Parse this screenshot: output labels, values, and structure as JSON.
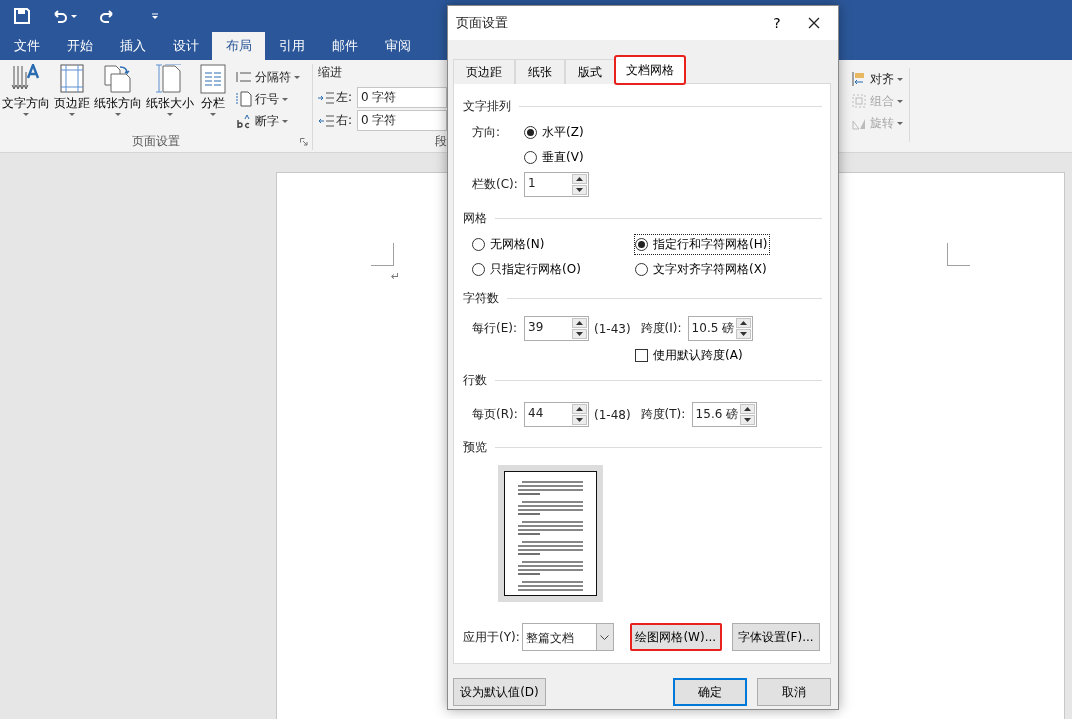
{
  "word": {
    "tabs": [
      {
        "label": "文件",
        "selected": false
      },
      {
        "label": "开始",
        "selected": false
      },
      {
        "label": "插入",
        "selected": false
      },
      {
        "label": "设计",
        "selected": false
      },
      {
        "label": "布局",
        "selected": true
      },
      {
        "label": "引用",
        "selected": false
      },
      {
        "label": "邮件",
        "selected": false
      },
      {
        "label": "审阅",
        "selected": false
      }
    ],
    "page_setup_group": {
      "title": "页面设置",
      "large_buttons": [
        {
          "label": "文字方向"
        },
        {
          "label": "页边距"
        },
        {
          "label": "纸张方向"
        },
        {
          "label": "纸张大小"
        },
        {
          "label": "分栏"
        }
      ],
      "small_buttons": [
        {
          "label": "分隔符"
        },
        {
          "label": "行号"
        },
        {
          "label": "断字"
        }
      ]
    },
    "indent_group": {
      "heading": "缩进",
      "fields": [
        {
          "label": "左:",
          "value": "0 字符"
        },
        {
          "label": "右:",
          "value": "0 字符"
        }
      ],
      "title": "段"
    },
    "arrange_buttons": [
      {
        "label": "对齐",
        "disabled": false
      },
      {
        "label": "组合",
        "disabled": true
      },
      {
        "label": "旋转",
        "disabled": true
      }
    ],
    "document": {
      "paragraph_mark": "↵"
    }
  },
  "dialog": {
    "title": "页面设置",
    "help": "?",
    "tabs": [
      {
        "label": "页边距",
        "selected": false,
        "highlighted": false
      },
      {
        "label": "纸张",
        "selected": false,
        "highlighted": false
      },
      {
        "label": "版式",
        "selected": false,
        "highlighted": false
      },
      {
        "label": "文档网格",
        "selected": true,
        "highlighted": true
      }
    ],
    "text_direction": {
      "heading": "文字排列",
      "direction_label": "方向:",
      "options": [
        {
          "label": "水平(Z)",
          "selected": true
        },
        {
          "label": "垂直(V)",
          "selected": false
        }
      ],
      "columns_label": "栏数(C):",
      "columns_value": "1"
    },
    "grid": {
      "heading": "网格",
      "options": [
        {
          "label": "无网格(N)",
          "selected": false,
          "focused": false
        },
        {
          "label": "指定行和字符网格(H)",
          "selected": true,
          "focused": true
        },
        {
          "label": "只指定行网格(O)",
          "selected": false,
          "focused": false
        },
        {
          "label": "文字对齐字符网格(X)",
          "selected": false,
          "focused": false
        }
      ]
    },
    "characters": {
      "heading": "字符数",
      "count_label": "每行(E):",
      "count_value": "39",
      "range": "(1-43)",
      "pitch_label": "跨度(I):",
      "pitch_value": "10.5 磅",
      "default_pitch": {
        "label": "使用默认跨度(A)",
        "checked": false
      }
    },
    "lines": {
      "heading": "行数",
      "count_label": "每页(R):",
      "count_value": "44",
      "range": "(1-48)",
      "pitch_label": "跨度(T):",
      "pitch_value": "15.6 磅"
    },
    "preview": {
      "heading": "预览"
    },
    "apply_to": {
      "label": "应用于(Y):",
      "value": "整篇文档"
    },
    "buttons": [
      {
        "label": "绘图网格(W)...",
        "highlighted": true
      },
      {
        "label": "字体设置(F)...",
        "highlighted": false
      }
    ],
    "footer_buttons": [
      {
        "label": "设为默认值(D)",
        "default": false
      },
      {
        "label": "确定",
        "default": true
      },
      {
        "label": "取消",
        "default": false
      }
    ]
  }
}
